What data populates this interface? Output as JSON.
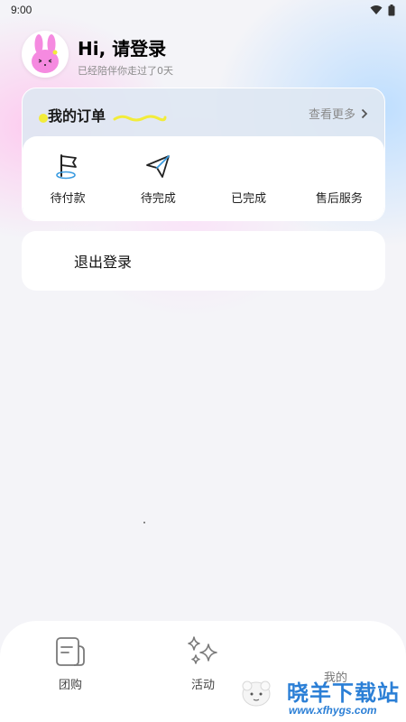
{
  "status_bar": {
    "time": "9:00"
  },
  "profile": {
    "greeting": "Hi, 请登录",
    "companion_text": "已经陪伴你走过了0天"
  },
  "orders": {
    "title": "我的订单",
    "view_more": "查看更多",
    "items": [
      {
        "label": "待付款",
        "icon": "flag-icon"
      },
      {
        "label": "待完成",
        "icon": "paper-plane-icon"
      },
      {
        "label": "已完成",
        "icon": ""
      },
      {
        "label": "售后服务",
        "icon": ""
      }
    ]
  },
  "logout": {
    "label": "退出登录"
  },
  "bottom_nav": {
    "items": [
      {
        "label": "团购",
        "icon": "notes-icon"
      },
      {
        "label": "活动",
        "icon": "sparkles-icon"
      },
      {
        "label": "我的",
        "icon": ""
      }
    ]
  },
  "watermark": {
    "title": "晓羊下载站",
    "url": "www.xfhygs.com"
  },
  "colors": {
    "accent_blue": "#2b7fd6",
    "highlight_yellow": "#f2ec3a",
    "avatar_pink": "#f58ae0"
  }
}
